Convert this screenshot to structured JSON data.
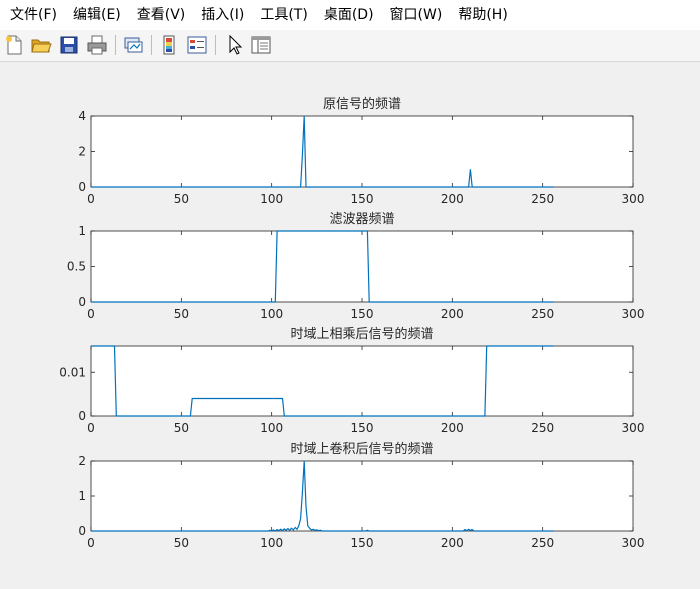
{
  "menu": {
    "items": [
      "文件(F)",
      "编辑(E)",
      "查看(V)",
      "插入(I)",
      "工具(T)",
      "桌面(D)",
      "窗口(W)",
      "帮助(H)"
    ]
  },
  "toolbar": {
    "icons": [
      "new-file-icon",
      "open-folder-icon",
      "save-icon",
      "print-icon",
      "link-plot-icon",
      "colorbar-icon",
      "legend-icon",
      "pointer-icon",
      "property-inspector-icon"
    ]
  },
  "colors": {
    "line": "#0072bd",
    "axes": "#262626",
    "plot_bg": "#ffffff",
    "figure_bg": "#f0f0f0"
  },
  "chart_data": [
    {
      "type": "line",
      "title": "原信号的频谱",
      "xlim": [
        0,
        300
      ],
      "ylim": [
        0,
        4
      ],
      "xticks": [
        0,
        50,
        100,
        150,
        200,
        250,
        300
      ],
      "yticks": [
        0,
        2,
        4
      ],
      "ytick_labels": [
        "0",
        "2",
        "4"
      ],
      "x": [
        0,
        116,
        117,
        118,
        119,
        209,
        210,
        211,
        212,
        256
      ],
      "y": [
        0,
        0,
        1.8,
        4.0,
        0,
        0,
        1.0,
        0,
        0,
        0
      ]
    },
    {
      "type": "line",
      "title": "滤波器频谱",
      "xlim": [
        0,
        300
      ],
      "ylim": [
        0,
        1
      ],
      "xticks": [
        0,
        50,
        100,
        150,
        200,
        250,
        300
      ],
      "yticks": [
        0,
        0.5,
        1
      ],
      "ytick_labels": [
        "0",
        "0.5",
        "1"
      ],
      "x": [
        0,
        102,
        103,
        153,
        154,
        256
      ],
      "y": [
        0,
        0,
        1,
        1,
        0,
        0
      ]
    },
    {
      "type": "line",
      "title": "时域上相乘后信号的频谱",
      "xlim": [
        0,
        300
      ],
      "ylim": [
        0,
        0.016
      ],
      "xticks": [
        0,
        50,
        100,
        150,
        200,
        250,
        300
      ],
      "yticks": [
        0,
        0.01
      ],
      "ytick_labels": [
        "0",
        "0.01"
      ],
      "x": [
        0,
        13,
        14,
        55,
        56,
        106,
        107,
        218,
        219,
        256
      ],
      "y": [
        0.016,
        0.016,
        0,
        0,
        0.004,
        0.004,
        0,
        0,
        0.016,
        0.016
      ]
    },
    {
      "type": "line",
      "title": "时域上卷积后信号的频谱",
      "xlim": [
        0,
        300
      ],
      "ylim": [
        0,
        2
      ],
      "xticks": [
        0,
        50,
        100,
        150,
        200,
        250,
        300
      ],
      "yticks": [
        0,
        1,
        2
      ],
      "ytick_labels": [
        "0",
        "1",
        "2"
      ],
      "x": [
        0,
        98,
        99,
        100,
        101,
        102,
        103,
        104,
        105,
        106,
        107,
        108,
        109,
        110,
        111,
        112,
        113,
        114,
        115,
        116,
        117,
        118,
        119,
        120,
        121,
        122,
        123,
        124,
        125,
        126,
        127,
        128,
        152,
        153,
        154,
        206,
        207,
        208,
        209,
        210,
        211,
        212,
        256
      ],
      "y": [
        0,
        0,
        0.02,
        0,
        0.03,
        0,
        0.04,
        0.01,
        0.05,
        0.01,
        0.06,
        0.02,
        0.07,
        0.02,
        0.08,
        0.03,
        0.1,
        0.05,
        0.15,
        0.35,
        1.1,
        2.0,
        0.7,
        0.15,
        0.08,
        0.03,
        0.05,
        0.02,
        0.03,
        0.01,
        0.02,
        0,
        0,
        0.02,
        0,
        0,
        0.04,
        0.01,
        0.05,
        0.02,
        0.04,
        0,
        0
      ]
    }
  ]
}
